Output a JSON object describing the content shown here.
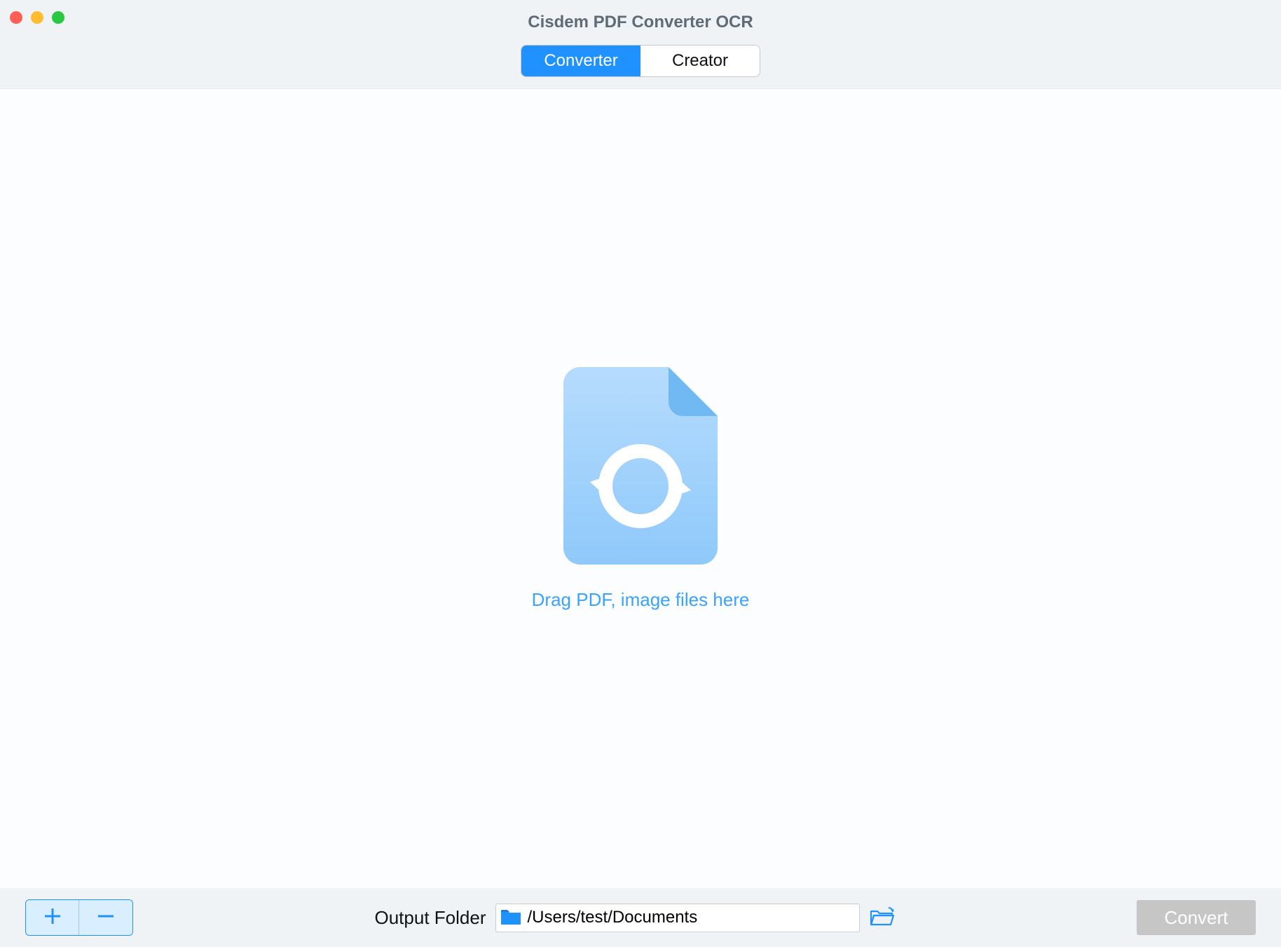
{
  "window": {
    "title": "Cisdem PDF Converter OCR"
  },
  "tabs": {
    "converter_label": "Converter",
    "creator_label": "Creator",
    "active": "converter"
  },
  "dropzone": {
    "prompt": "Drag PDF, image files here"
  },
  "footer": {
    "output_label": "Output Folder",
    "output_path": "/Users/test/Documents",
    "convert_label": "Convert"
  }
}
